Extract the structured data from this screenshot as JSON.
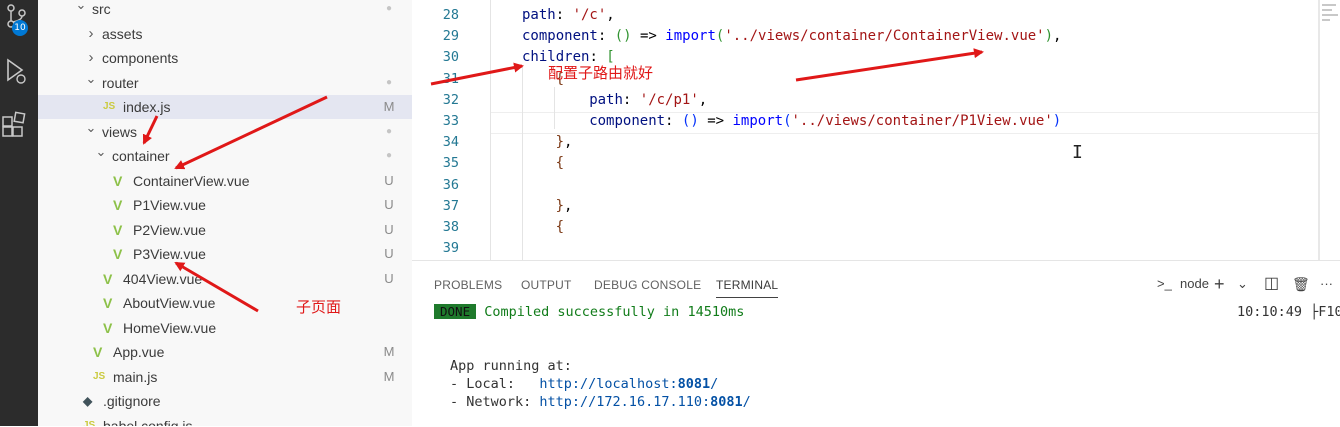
{
  "activity_bar": {
    "icons": [
      "source-control-icon",
      "run-debug-icon",
      "extensions-icon"
    ],
    "source_control_badge": "10"
  },
  "explorer": {
    "items": [
      {
        "label": "src",
        "kind": "folder-open",
        "status": "●"
      },
      {
        "label": "assets",
        "kind": "folder-closed",
        "status": ""
      },
      {
        "label": "components",
        "kind": "folder-closed",
        "status": ""
      },
      {
        "label": "router",
        "kind": "folder-open",
        "status": "●"
      },
      {
        "label": "index.js",
        "kind": "js",
        "status": "M",
        "selected": true
      },
      {
        "label": "views",
        "kind": "folder-open",
        "status": "●"
      },
      {
        "label": "container",
        "kind": "folder-open",
        "status": "●"
      },
      {
        "label": "ContainerView.vue",
        "kind": "vue",
        "status": "U"
      },
      {
        "label": "P1View.vue",
        "kind": "vue",
        "status": "U"
      },
      {
        "label": "P2View.vue",
        "kind": "vue",
        "status": "U"
      },
      {
        "label": "P3View.vue",
        "kind": "vue",
        "status": "U"
      },
      {
        "label": "404View.vue",
        "kind": "vue",
        "status": "U"
      },
      {
        "label": "AboutView.vue",
        "kind": "vue",
        "status": ""
      },
      {
        "label": "HomeView.vue",
        "kind": "vue",
        "status": ""
      },
      {
        "label": "App.vue",
        "kind": "vue",
        "status": "M"
      },
      {
        "label": "main.js",
        "kind": "js",
        "status": "M"
      },
      {
        "label": ".gitignore",
        "kind": "git",
        "status": ""
      },
      {
        "label": "babel.config.js",
        "kind": "js",
        "status": ""
      }
    ],
    "icon_glyphs": {
      "vue": "V",
      "js": "JS",
      "git": "◆"
    }
  },
  "editor": {
    "lines": [
      {
        "n": "28",
        "tokens": [
          [
            "prop",
            "path"
          ],
          [
            "punc",
            ": "
          ],
          [
            "str",
            "'/c'"
          ],
          [
            "punc",
            ","
          ]
        ]
      },
      {
        "n": "29",
        "tokens": [
          [
            "prop",
            "component"
          ],
          [
            "punc",
            ": "
          ],
          [
            "brk2",
            "()"
          ],
          [
            "punc",
            " => "
          ],
          [
            "key",
            "import"
          ],
          [
            "brk2",
            "("
          ],
          [
            "str",
            "'../views/container/ContainerView.vue'"
          ],
          [
            "brk2",
            ")"
          ],
          [
            "punc",
            ","
          ]
        ]
      },
      {
        "n": "30",
        "tokens": [
          [
            "prop",
            "children"
          ],
          [
            "punc",
            ": "
          ],
          [
            "brk2",
            "["
          ]
        ]
      },
      {
        "n": "31",
        "tokens": [
          [
            "brk3",
            "{"
          ]
        ]
      },
      {
        "n": "32",
        "tokens": [
          [
            "prop",
            "path"
          ],
          [
            "punc",
            ": "
          ],
          [
            "str",
            "'/c/p1'"
          ],
          [
            "punc",
            ","
          ]
        ]
      },
      {
        "n": "33",
        "tokens": [
          [
            "prop",
            "component"
          ],
          [
            "punc",
            ": "
          ],
          [
            "brk1",
            "()"
          ],
          [
            "punc",
            " => "
          ],
          [
            "key",
            "import"
          ],
          [
            "brk1",
            "("
          ],
          [
            "str",
            "'../views/container/P1View.vue'"
          ],
          [
            "brk1",
            ")"
          ]
        ]
      },
      {
        "n": "34",
        "tokens": [
          [
            "brk3",
            "}"
          ],
          [
            "punc",
            ","
          ]
        ]
      },
      {
        "n": "35",
        "tokens": [
          [
            "brk3",
            "{"
          ]
        ]
      },
      {
        "n": "36",
        "tokens": []
      },
      {
        "n": "37",
        "tokens": [
          [
            "brk3",
            "}"
          ],
          [
            "punc",
            ","
          ]
        ]
      },
      {
        "n": "38",
        "tokens": [
          [
            "brk3",
            "{"
          ]
        ]
      },
      {
        "n": "39",
        "tokens": []
      }
    ],
    "line_indents": [
      1,
      1,
      1,
      2,
      3,
      3,
      2,
      2,
      3,
      2,
      2,
      3
    ],
    "cursor_glyph": "I"
  },
  "panel": {
    "tabs": [
      {
        "label": "PROBLEMS",
        "active": false
      },
      {
        "label": "OUTPUT",
        "active": false
      },
      {
        "label": "DEBUG CONSOLE",
        "active": false
      },
      {
        "label": "TERMINAL",
        "active": true
      }
    ],
    "tools": {
      "terminal_icon": ">_",
      "shell_name": "node",
      "add": "+",
      "dropdown": "⌄",
      "split": "◫",
      "trash": "🗑",
      "more": "···"
    },
    "terminal": {
      "badge": "DONE",
      "compiled": "Compiled successfully in 14510ms",
      "time": "10:10:49",
      "time_suffix": "├F10",
      "running": "App running at:",
      "local_label": "- Local:   ",
      "local_url_prefix": "http://localhost:",
      "local_port": "8081",
      "local_url_suffix": "/",
      "network_label": "- Network: ",
      "network_url_prefix": "http://172.16.17.110:",
      "network_port": "8081",
      "network_url_suffix": "/"
    }
  },
  "annotations": {
    "color": "#e01818",
    "note_children": "配置子路由就好",
    "note_subpage": "子页面"
  }
}
